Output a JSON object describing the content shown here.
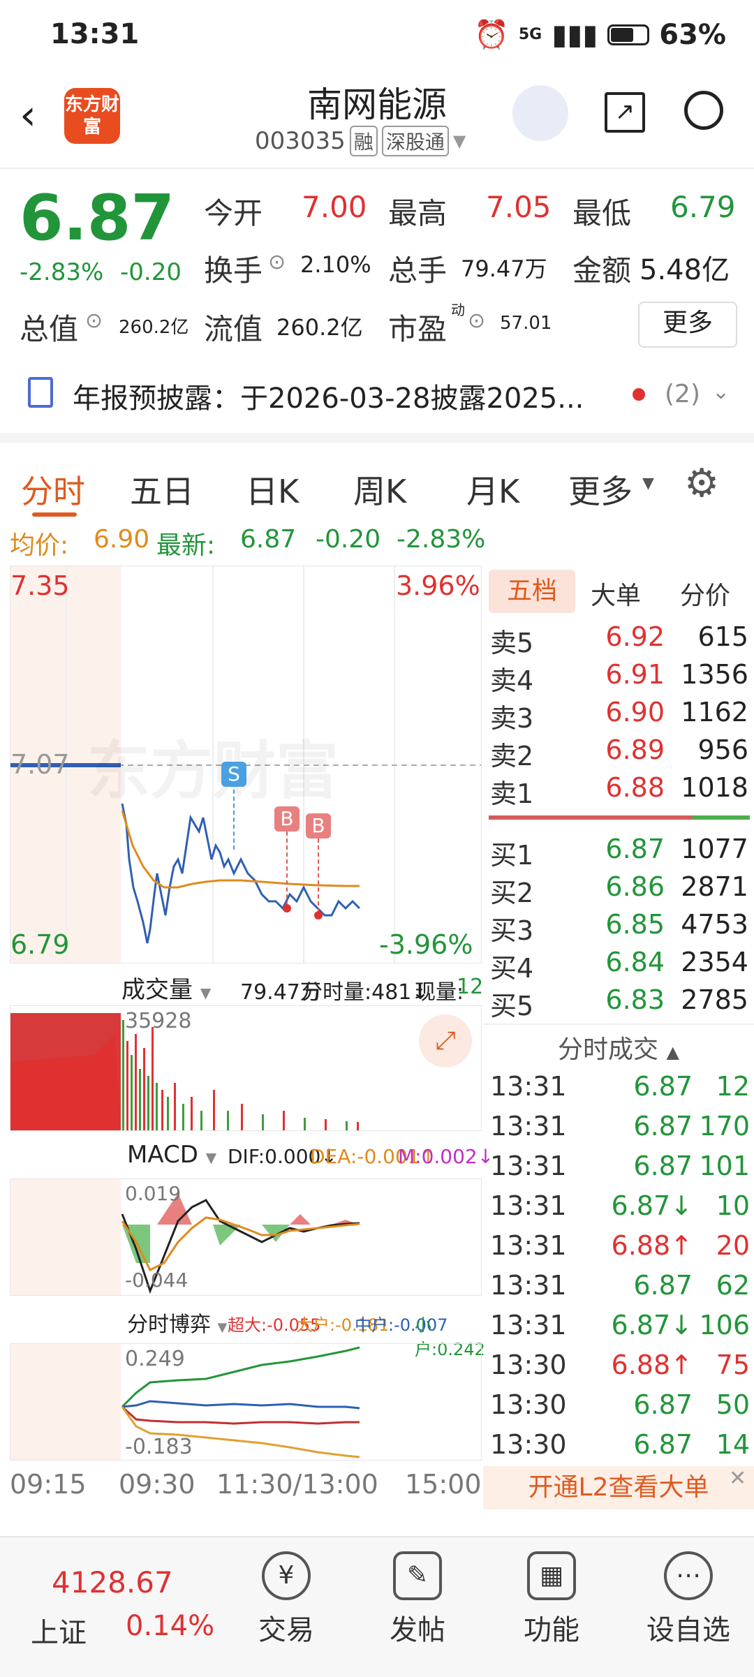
{
  "status_bar": {
    "time": "13:31",
    "network": "5G",
    "battery": "63%"
  },
  "header": {
    "logo_text": "东方财富",
    "title": "南网能源",
    "code": "003035",
    "tags": [
      "融",
      "深股通"
    ]
  },
  "quote": {
    "price": "6.87",
    "change_pct": "-2.83%",
    "change": "-0.20",
    "fields": [
      {
        "label": "今开",
        "value": "7.00"
      },
      {
        "label": "最高",
        "value": "7.05"
      },
      {
        "label": "最低",
        "value": "6.79"
      },
      {
        "label": "换手",
        "value": "2.10%"
      },
      {
        "label": "总手",
        "value": "79.47万"
      },
      {
        "label": "金额",
        "value": "5.48亿"
      },
      {
        "label": "总值",
        "value": "260.2亿"
      },
      {
        "label": "流值",
        "value": "260.2亿"
      },
      {
        "label": "市盈",
        "value": "57.01"
      }
    ],
    "pe_superscript": "动",
    "more_button": "更多"
  },
  "notice": {
    "text": "年报预披露：于2026-03-28披露2025...",
    "count": "(2)"
  },
  "tabs": [
    "分时",
    "五日",
    "日K",
    "周K",
    "月K",
    "更多"
  ],
  "avg_line": {
    "avg_label": "均价:",
    "avg_value": "6.90",
    "latest_label": "最新:",
    "latest_value": "6.87",
    "change": "-0.20",
    "change_pct": "-2.83%"
  },
  "chart": {
    "y_max": "7.35",
    "y_mid": "7.07",
    "y_min": "6.79",
    "pct_max": "3.96%",
    "pct_min": "-3.96%",
    "watermark": "东方财富",
    "markers": [
      "S",
      "B",
      "B"
    ],
    "x_labels": [
      "09:15",
      "09:30",
      "11:30/13:00",
      "15:00"
    ]
  },
  "volume": {
    "label": "成交量",
    "total": "79.47万",
    "minute": "分时量:481↓",
    "current_label": "现量:",
    "current_value": "12",
    "peak": "35928"
  },
  "macd": {
    "label": "MACD",
    "dif": "DIF:0.000↓",
    "dea": "DEA:-0.001↑",
    "m": "M:0.002↓",
    "top": "0.019",
    "bottom": "-0.044"
  },
  "game": {
    "label": "分时博弈",
    "chaoda": "超大:-0.055",
    "dahu": "大户:-0.181",
    "zhonghu": "中户:-0.007",
    "xiaohu": "小户:0.242",
    "top": "0.249",
    "bottom": "-0.183"
  },
  "order_book": {
    "tabs": [
      "五档",
      "大单",
      "分价"
    ],
    "sells": [
      {
        "label": "卖5",
        "price": "6.92",
        "vol": "615"
      },
      {
        "label": "卖4",
        "price": "6.91",
        "vol": "1356"
      },
      {
        "label": "卖3",
        "price": "6.90",
        "vol": "1162"
      },
      {
        "label": "卖2",
        "price": "6.89",
        "vol": "956"
      },
      {
        "label": "卖1",
        "price": "6.88",
        "vol": "1018"
      }
    ],
    "buys": [
      {
        "label": "买1",
        "price": "6.87",
        "vol": "1077"
      },
      {
        "label": "买2",
        "price": "6.86",
        "vol": "2871"
      },
      {
        "label": "买3",
        "price": "6.85",
        "vol": "4753"
      },
      {
        "label": "买4",
        "price": "6.84",
        "vol": "2354"
      },
      {
        "label": "买5",
        "price": "6.83",
        "vol": "2785"
      }
    ]
  },
  "trades": {
    "title": "分时成交",
    "rows": [
      {
        "time": "13:31",
        "price": "6.87",
        "vol": "12",
        "dir": ""
      },
      {
        "time": "13:31",
        "price": "6.87",
        "vol": "170",
        "dir": ""
      },
      {
        "time": "13:31",
        "price": "6.87",
        "vol": "101",
        "dir": ""
      },
      {
        "time": "13:31",
        "price": "6.87↓",
        "vol": "10",
        "dir": "down"
      },
      {
        "time": "13:31",
        "price": "6.88↑",
        "vol": "20",
        "dir": "up"
      },
      {
        "time": "13:31",
        "price": "6.87",
        "vol": "62",
        "dir": ""
      },
      {
        "time": "13:31",
        "price": "6.87↓",
        "vol": "106",
        "dir": "down"
      },
      {
        "time": "13:30",
        "price": "6.88↑",
        "vol": "75",
        "dir": "up"
      },
      {
        "time": "13:30",
        "price": "6.87",
        "vol": "50",
        "dir": ""
      },
      {
        "time": "13:30",
        "price": "6.87",
        "vol": "14",
        "dir": ""
      }
    ],
    "l2_banner": "开通L2查看大单"
  },
  "bottom_bar": {
    "index_value": "4128.67",
    "index_name": "上证",
    "index_pct": "0.14%",
    "items": [
      "交易",
      "发帖",
      "功能",
      "设自选"
    ]
  },
  "colors": {
    "up": "#e03131",
    "down": "#22953a",
    "accent": "#e84c1f",
    "avg": "#e08a1c",
    "price_line": "#2f5fb3"
  }
}
